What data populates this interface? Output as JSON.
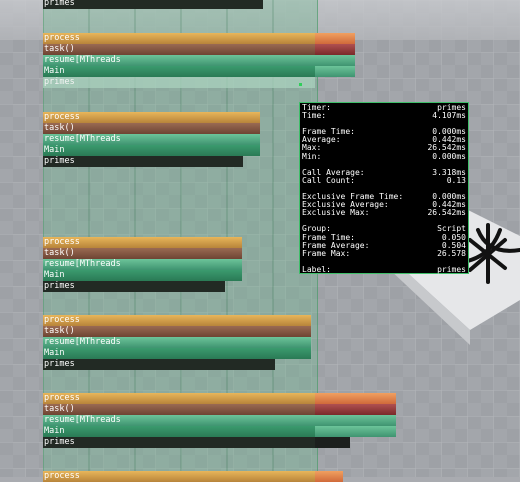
{
  "bar_labels": {
    "process": "process",
    "task": "task()",
    "resume": "resume[MThreads",
    "main": "Main",
    "primes": "primes"
  },
  "tooltip": {
    "timer_label": "Timer:",
    "timer_value": "primes",
    "time_label": "Time:",
    "time_value": "4.107ms",
    "frame_time_label": "Frame Time:",
    "frame_time_value": "0.000ms",
    "average_label": "Average:",
    "average_value": "0.442ms",
    "max_label": "Max:",
    "max_value": "26.542ms",
    "min_label": "Min:",
    "min_value": "0.000ms",
    "call_average_label": "Call Average:",
    "call_average_value": "3.318ms",
    "call_count_label": "Call Count:",
    "call_count_value": "0.13",
    "excl_frame_time_label": "Exclusive Frame Time:",
    "excl_frame_time_value": "0.000ms",
    "excl_average_label": "Exclusive Average:",
    "excl_average_value": "0.442ms",
    "excl_max_label": "Exclusive Max:",
    "excl_max_value": "26.542ms",
    "group_label": "Group:",
    "group_value": "Script",
    "group_frame_time_label": "Frame Time:",
    "group_frame_time_value": "0.050",
    "group_frame_average_label": "Frame Average:",
    "group_frame_average_value": "0.504",
    "group_frame_max_label": "Frame Max:",
    "group_frame_max_value": "26.578",
    "label_label": "Label:",
    "label_value": "primes"
  },
  "colors": {
    "process": "#d9a24f",
    "task": "#84563f",
    "resume": "#56ad84",
    "main": "#3b9a6e",
    "primes": "#222a24",
    "tooltip_border": "#3fbf6a"
  }
}
